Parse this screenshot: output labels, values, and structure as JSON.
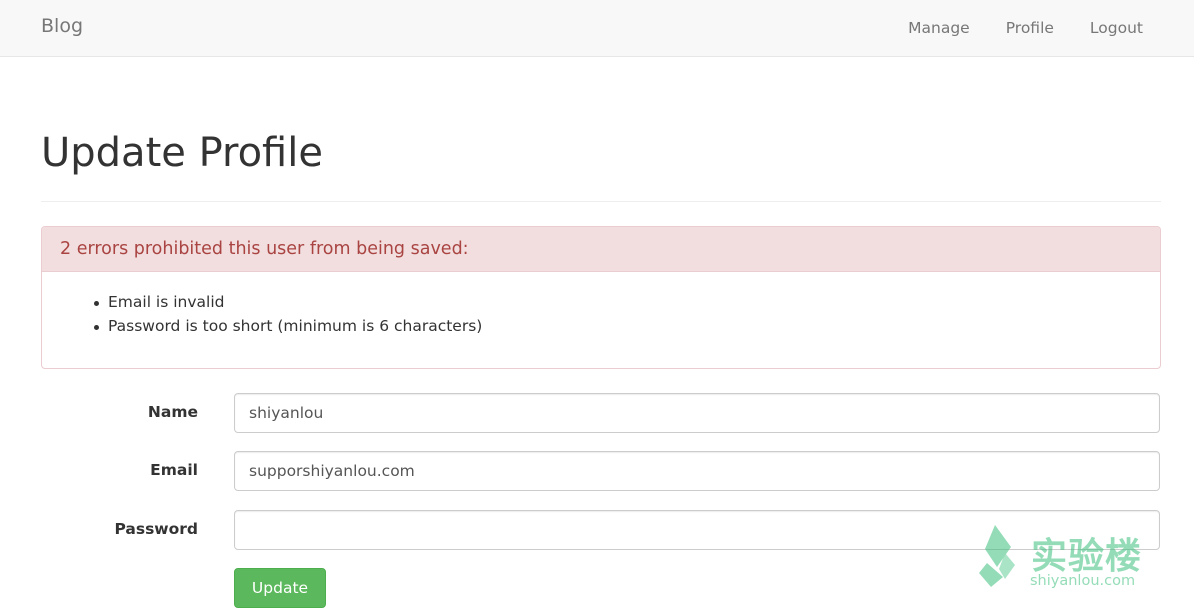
{
  "navbar": {
    "brand": "Blog",
    "links": [
      "Manage",
      "Profile",
      "Logout"
    ]
  },
  "page": {
    "title": "Update Profile"
  },
  "errors": {
    "heading": "2 errors prohibited this user from being saved:",
    "messages": [
      "Email is invalid",
      "Password is too short (minimum is 6 characters)"
    ]
  },
  "form": {
    "name_label": "Name",
    "name_value": "shiyanlou",
    "email_label": "Email",
    "email_value": "supporshiyanlou.com",
    "password_label": "Password",
    "password_value": "",
    "submit_label": "Update"
  },
  "watermark": {
    "text_cn": "实验楼",
    "text_en": "shiyanlou.com"
  },
  "colors": {
    "error_bg": "#f2dede",
    "error_text": "#a94442",
    "button_green": "#5cb85c",
    "watermark_green": "#3ec07e"
  }
}
